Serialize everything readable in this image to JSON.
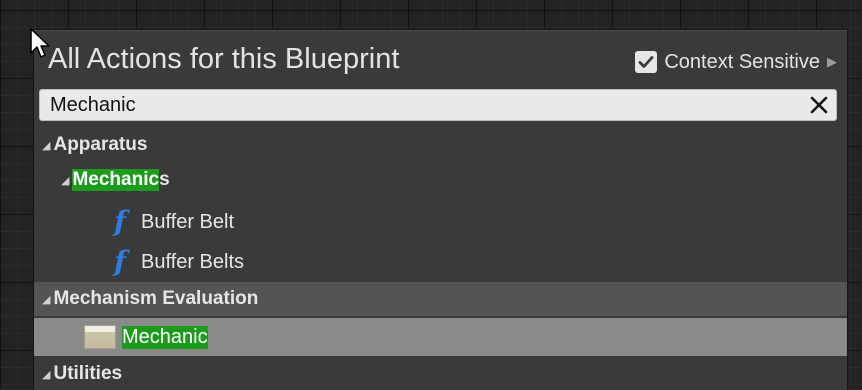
{
  "panel": {
    "title": "All Actions for this Blueprint",
    "context_sensitive": {
      "label": "Context Sensitive",
      "checked": true,
      "arrow_icon": "triangle-right-icon"
    }
  },
  "search": {
    "value": "Mechanic",
    "clear_icon": "close-icon"
  },
  "tree": {
    "apparatus": {
      "label": "Apparatus"
    },
    "mechanics": {
      "label_match": "Mechanic",
      "label_rest": "s"
    },
    "buffer_belt": {
      "label": "Buffer Belt",
      "icon": "function-icon"
    },
    "buffer_belts": {
      "label": "Buffer Belts",
      "icon": "function-icon"
    },
    "mechanism_evaluation": {
      "label": "Mechanism Evaluation"
    },
    "mechanic": {
      "label": "Mechanic",
      "icon": "struct-variable-icon"
    },
    "utilities": {
      "label": "Utilities"
    },
    "expand_glyph": "◢",
    "function_glyph": "f"
  },
  "colors": {
    "match_highlight": "#1d9b1d",
    "function_icon": "#2c7fe0",
    "category_band": "#545454",
    "selected_band": "#8a8a8a"
  }
}
